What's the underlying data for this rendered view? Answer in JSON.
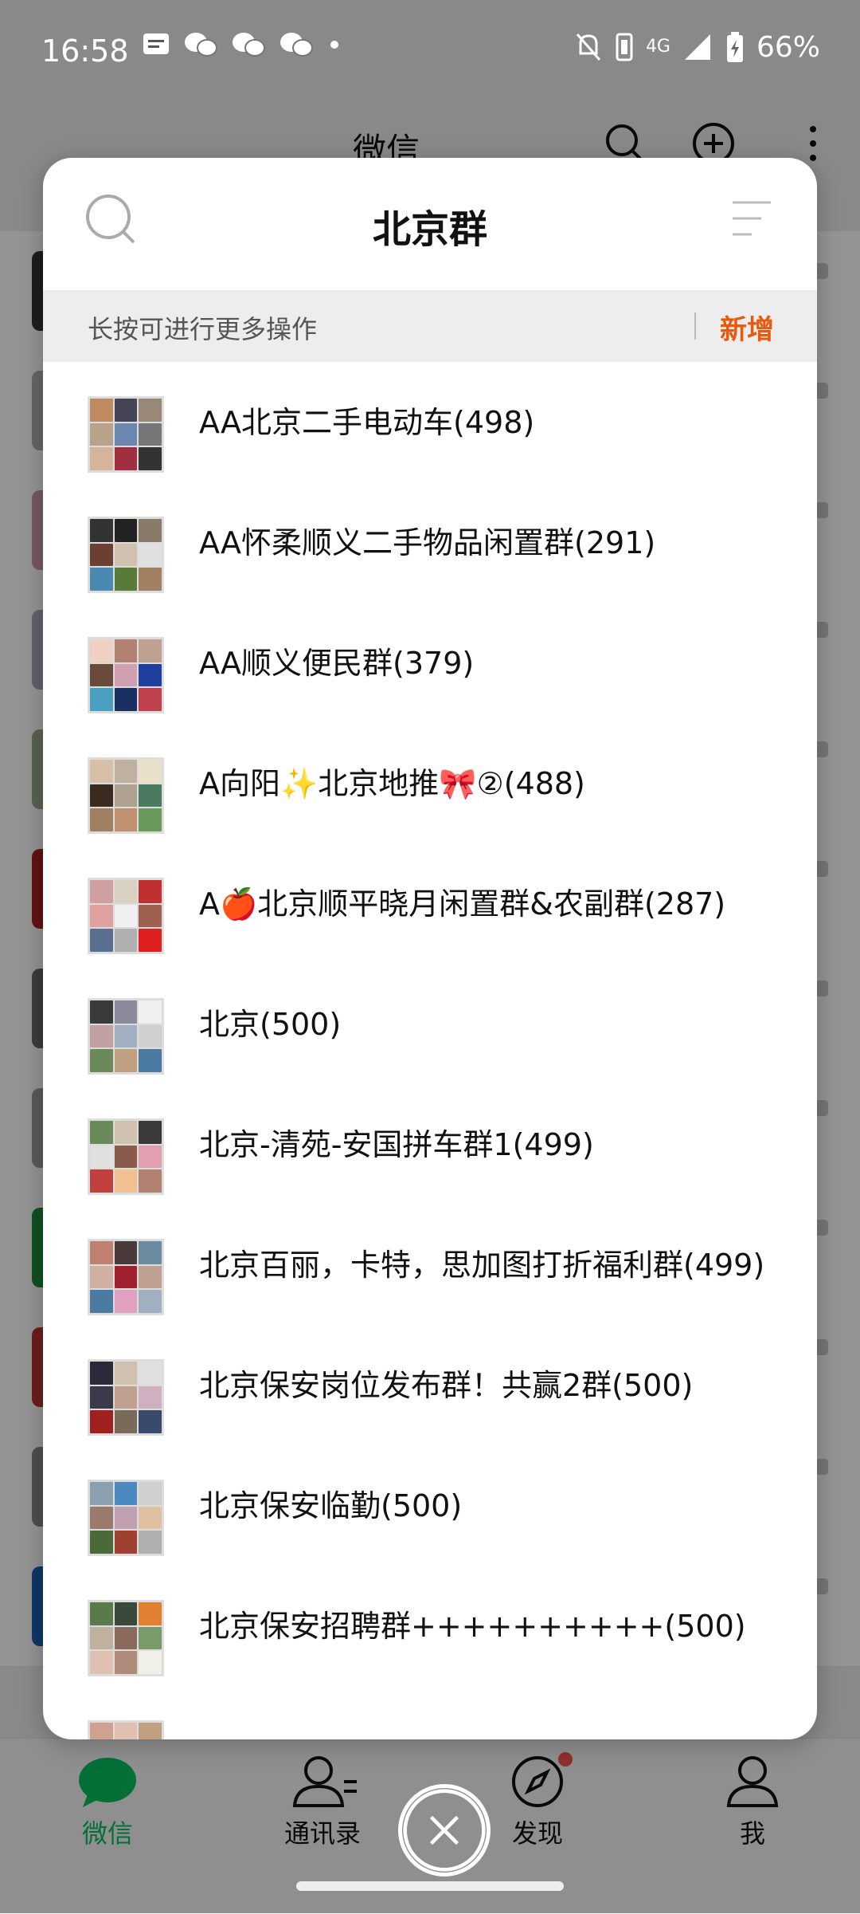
{
  "status_bar": {
    "time": "16:58",
    "battery": "66%",
    "network": "4G"
  },
  "background": {
    "title": "微信",
    "tabs": [
      {
        "label": "微信",
        "icon": "chat-bubble-icon",
        "active": true
      },
      {
        "label": "通讯录",
        "icon": "contacts-icon",
        "active": false
      },
      {
        "label": "发现",
        "icon": "compass-icon",
        "active": false,
        "badge_dot": true
      },
      {
        "label": "我",
        "icon": "person-icon",
        "active": false
      }
    ]
  },
  "dialog": {
    "title": "北京群",
    "hint": "长按可进行更多操作",
    "add_label": "新增",
    "groups": [
      {
        "name": "AA北京二手电动车(498)"
      },
      {
        "name": "AA怀柔顺义二手物品闲置群(291)"
      },
      {
        "name": "AA顺义便民群(379)"
      },
      {
        "name": "A向阳✨北京地推🎀②(488)"
      },
      {
        "name": "A🍎北京顺平晓月闲置群&农副群(287)"
      },
      {
        "name": "北京(500)"
      },
      {
        "name": "北京-清苑-安国拼车群1(499)"
      },
      {
        "name": "北京百丽，卡特，思加图打折福利群(499)"
      },
      {
        "name": "北京保安岗位发布群！共赢2群(500)"
      },
      {
        "name": "北京保安临勤(500)"
      },
      {
        "name": "北京保安招聘群++++++++++(500)"
      },
      {
        "name": ""
      }
    ]
  },
  "colors": {
    "accent_green": "#07c160",
    "accent_orange": "#e8590c"
  }
}
